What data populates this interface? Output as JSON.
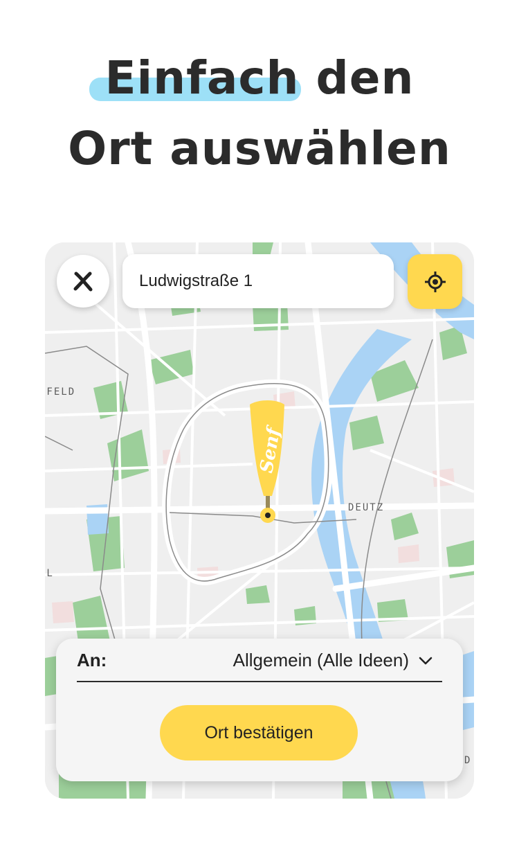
{
  "headline": {
    "highlight": "Einfach",
    "line1_rest": "den",
    "line2": "Ort auswählen"
  },
  "topbar": {
    "close_icon": "close-x-icon",
    "address": "Ludwigstraße 1",
    "locate_icon": "crosshair-location-icon"
  },
  "map": {
    "labels": {
      "left_district": "NFELD",
      "east_district": "DEUTZ",
      "left_edge": "AL",
      "right_edge": "D"
    },
    "pin_text": "Senf"
  },
  "sheet": {
    "an_label": "An:",
    "audience": "Allgemein (Alle Ideen)",
    "confirm_label": "Ort bestätigen"
  },
  "colors": {
    "accent_yellow": "#ffd84f",
    "highlight_blue": "#9de0f7",
    "river": "#aad3f5",
    "park_green": "#9ccf9a"
  }
}
